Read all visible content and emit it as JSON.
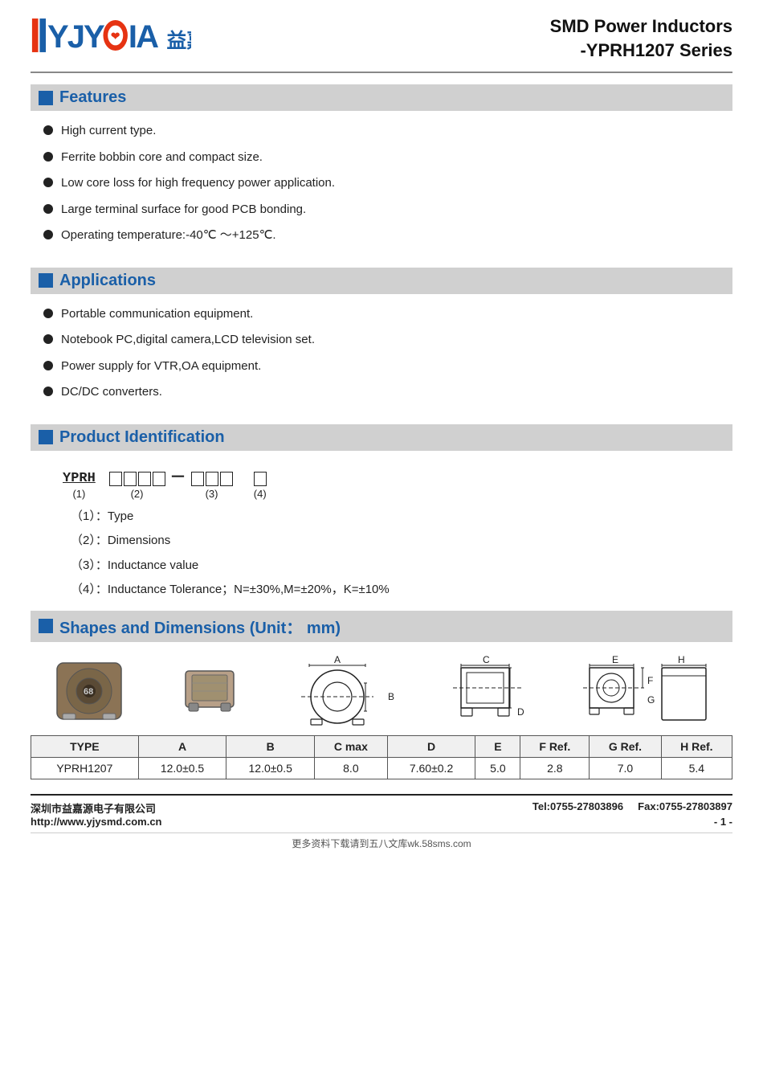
{
  "header": {
    "title_line1": "SMD Power Inductors",
    "title_line2": "-YPRH1207 Series",
    "logo_text": "益嘉源"
  },
  "features": {
    "section_title": "Features",
    "items": [
      "High current type.",
      "Ferrite bobbin core and compact size.",
      "Low core loss for high frequency power application.",
      "Large terminal surface for good PCB bonding.",
      "Operating temperature:-40℃ ～+125℃."
    ]
  },
  "applications": {
    "section_title": "Applications",
    "items": [
      "Portable communication equipment.",
      "Notebook PC,digital camera,LCD television set.",
      "Power supply for VTR,OA equipment.",
      "DC/DC converters."
    ]
  },
  "product_identification": {
    "section_title": "Product Identification",
    "prefix": "YPRH",
    "label1": "(1)",
    "label2": "(2)",
    "label3": "(3)",
    "label4": "(4)",
    "items": [
      {
        "num": "（1）：",
        "desc": "Type"
      },
      {
        "num": "（2）：",
        "desc": "Dimensions"
      },
      {
        "num": "（3）：",
        "desc": "Inductance value"
      },
      {
        "num": "（4）：",
        "desc": "Inductance Tolerance；N=±30%,M=±20%，K=±10%"
      }
    ]
  },
  "shapes": {
    "section_title": "Shapes and Dimensions (Unit：  mm)",
    "table": {
      "headers": [
        "TYPE",
        "A",
        "B",
        "C max",
        "D",
        "E",
        "F Ref.",
        "G Ref.",
        "H Ref."
      ],
      "rows": [
        [
          "YPRH1207",
          "12.0±0.5",
          "12.0±0.5",
          "8.0",
          "7.60±0.2",
          "5.0",
          "2.8",
          "7.0",
          "5.4"
        ]
      ]
    }
  },
  "footer": {
    "company": "深圳市益嘉源电子有限公司",
    "website": "http://www.yjysmd.com.cn",
    "tel": "Tel:0755-27803896",
    "fax": "Fax:0755-27803897",
    "page": "- 1 -",
    "watermark": "更多资料下载请到五八文库wk.58sms.com"
  }
}
